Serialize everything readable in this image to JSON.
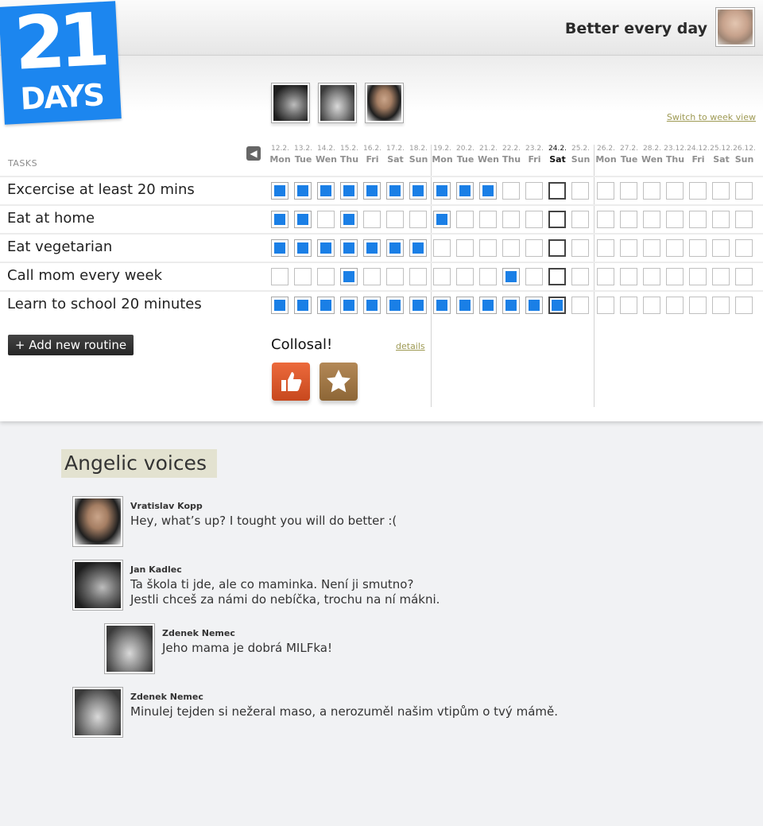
{
  "logo": {
    "number": "21",
    "word": "DAYS"
  },
  "header": {
    "tagline": "Better every day"
  },
  "switch_link": "Switch to week view",
  "tasks_label": "TASKS",
  "dates": [
    {
      "date": "12.2.",
      "day": "Mon"
    },
    {
      "date": "13.2.",
      "day": "Tue"
    },
    {
      "date": "14.2.",
      "day": "Wen"
    },
    {
      "date": "15.2.",
      "day": "Thu"
    },
    {
      "date": "16.2.",
      "day": "Fri"
    },
    {
      "date": "17.2.",
      "day": "Sat"
    },
    {
      "date": "18.2.",
      "day": "Sun"
    },
    {
      "date": "19.2.",
      "day": "Mon"
    },
    {
      "date": "20.2.",
      "day": "Tue"
    },
    {
      "date": "21.2.",
      "day": "Wen"
    },
    {
      "date": "22.2.",
      "day": "Thu"
    },
    {
      "date": "23.2.",
      "day": "Fri"
    },
    {
      "date": "24.2.",
      "day": "Sat",
      "today": true
    },
    {
      "date": "25.2.",
      "day": "Sun"
    },
    {
      "date": "26.2.",
      "day": "Mon"
    },
    {
      "date": "27.2.",
      "day": "Tue"
    },
    {
      "date": "28.2.",
      "day": "Wen"
    },
    {
      "date": "23.12.",
      "day": "Thu"
    },
    {
      "date": "24.12.",
      "day": "Fri"
    },
    {
      "date": "25.12.",
      "day": "Sat"
    },
    {
      "date": "26.12.",
      "day": "Sun"
    }
  ],
  "tasks": [
    {
      "name": "Excercise at least 20 mins",
      "checks": [
        1,
        1,
        1,
        1,
        1,
        1,
        1,
        1,
        1,
        1,
        0,
        0,
        0,
        0,
        0,
        0,
        0,
        0,
        0,
        0,
        0
      ]
    },
    {
      "name": "Eat at home",
      "checks": [
        1,
        1,
        0,
        1,
        0,
        0,
        0,
        1,
        0,
        0,
        0,
        0,
        0,
        0,
        0,
        0,
        0,
        0,
        0,
        0,
        0
      ]
    },
    {
      "name": "Eat vegetarian",
      "checks": [
        1,
        1,
        1,
        1,
        1,
        1,
        1,
        0,
        0,
        0,
        0,
        0,
        0,
        0,
        0,
        0,
        0,
        0,
        0,
        0,
        0
      ]
    },
    {
      "name": "Call mom every week",
      "checks": [
        0,
        0,
        0,
        1,
        0,
        0,
        0,
        0,
        0,
        0,
        1,
        0,
        0,
        0,
        0,
        0,
        0,
        0,
        0,
        0,
        0
      ]
    },
    {
      "name": "Learn to school 20 minutes",
      "checks": [
        1,
        1,
        1,
        1,
        1,
        1,
        1,
        1,
        1,
        1,
        1,
        1,
        1,
        0,
        0,
        0,
        0,
        0,
        0,
        0,
        0
      ]
    }
  ],
  "add_button": "+ Add new routine",
  "award": {
    "title": "Collosal!",
    "details": "details",
    "badges": [
      "thumbs-up-icon",
      "star-icon"
    ]
  },
  "section_title": "Angelic voices",
  "comments": [
    {
      "author": "Vratislav Kopp",
      "text": "Hey, what’s up? I tought you will do better :(",
      "avatar": "av3"
    },
    {
      "author": "Jan Kadlec",
      "text": "Ta škola ti jde, ale co maminka. Není ji smutno?\nJestli chceš za námi do nebíčka, trochu na ní mákni.",
      "avatar": "av1"
    },
    {
      "author": "Zdenek Nemec",
      "text": "Jeho mama je dobrá MILFka!",
      "avatar": "av2",
      "reply": true
    },
    {
      "author": "Zdenek Nemec",
      "text": "Minulej tejden si nežeral maso, a nerozuměl našim vtipům o tvý mámě.",
      "avatar": "av2"
    }
  ],
  "colors": {
    "brand": "#1c86ef",
    "check": "#1a7fe6",
    "link": "#9e9a54",
    "section_bg": "#e3e2d0"
  }
}
